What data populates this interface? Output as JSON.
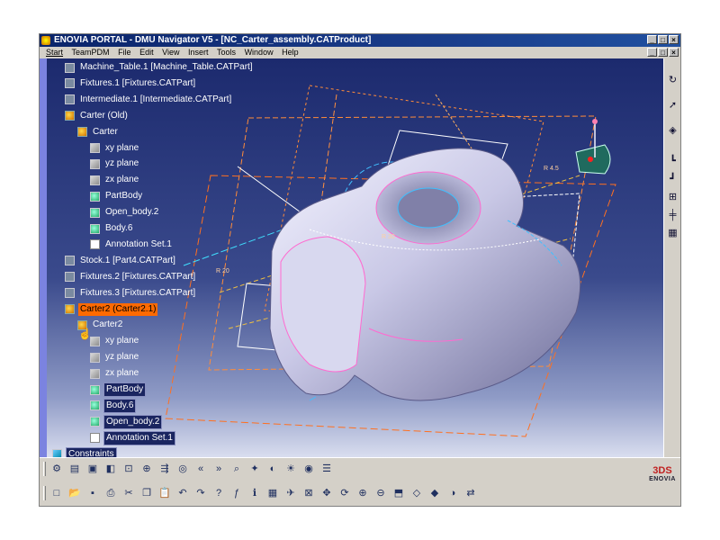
{
  "window": {
    "title": "ENOVIA PORTAL - DMU Navigator V5 - [NC_Carter_assembly.CATProduct]",
    "controls": [
      "_",
      "□",
      "×"
    ],
    "doc_controls": [
      "_",
      "□",
      "×"
    ]
  },
  "menubar": [
    "Start",
    "TeamPDM",
    "File",
    "Edit",
    "View",
    "Insert",
    "Tools",
    "Window",
    "Help"
  ],
  "tree": [
    {
      "label": "Machine_Table.1 [Machine_Table.CATPart]",
      "icon": "part-icon"
    },
    {
      "label": "Fixtures.1 [Fixtures.CATPart]",
      "icon": "part-icon"
    },
    {
      "label": "Intermediate.1 [Intermediate.CATPart]",
      "icon": "part-icon"
    },
    {
      "label": "Carter (Old)",
      "icon": "product-icon"
    },
    {
      "label": "Carter",
      "icon": "product-icon"
    },
    {
      "label": "xy plane",
      "icon": "plane-icon"
    },
    {
      "label": "yz plane",
      "icon": "plane-icon"
    },
    {
      "label": "zx plane",
      "icon": "plane-icon"
    },
    {
      "label": "PartBody",
      "icon": "body-icon"
    },
    {
      "label": "Open_body.2",
      "icon": "body-icon"
    },
    {
      "label": "Body.6",
      "icon": "body-icon"
    },
    {
      "label": "Annotation Set.1",
      "icon": "annotation-icon"
    },
    {
      "label": "Stock.1 [Part4.CATPart]",
      "icon": "part-icon"
    },
    {
      "label": "Fixtures.2 [Fixtures.CATPart]",
      "icon": "part-icon"
    },
    {
      "label": "Fixtures.3 [Fixtures.CATPart]",
      "icon": "part-icon"
    },
    {
      "label": "Carter2 (Carter2.1)",
      "icon": "product-icon"
    },
    {
      "label": "Carter2",
      "icon": "product-icon"
    },
    {
      "label": "xy plane",
      "icon": "plane-icon"
    },
    {
      "label": "yz plane",
      "icon": "plane-icon"
    },
    {
      "label": "zx plane",
      "icon": "plane-icon"
    },
    {
      "label": "PartBody",
      "icon": "body-icon"
    },
    {
      "label": "Body.6",
      "icon": "body-icon"
    },
    {
      "label": "Open_body.2",
      "icon": "body-icon"
    },
    {
      "label": "Annotation Set.1",
      "icon": "annotation-icon"
    },
    {
      "label": "Constraints",
      "icon": "constraints-icon"
    }
  ],
  "selected_item": "Carter2 (Carter2.1)",
  "right_toolbar": [
    "rotate-icon",
    "select-arrow-icon",
    "measure-icon",
    "tree-expand-icon",
    "tree-collapse-icon",
    "product-node-icon",
    "constraint-icon",
    "grid-icon"
  ],
  "bottom_toolbar_row1": [
    "clash-icon",
    "section-icon",
    "distance-icon",
    "annotation-icon",
    "group-icon",
    "filter-icon",
    "move-icon",
    "compass-icon",
    "previous-view-icon",
    "next-view-icon",
    "search-icon",
    "explode-icon",
    "swept-volume-icon",
    "light-icon",
    "camera-icon",
    "list-icon"
  ],
  "bottom_toolbar_row2": [
    "new-icon",
    "open-icon",
    "save-icon",
    "print-icon",
    "cut-icon",
    "copy-icon",
    "paste-icon",
    "undo-icon",
    "redo-icon",
    "help-icon",
    "formula-icon",
    "info-icon",
    "table-icon",
    "fly-icon",
    "fit-all-icon",
    "pan-icon",
    "rotate-view-icon",
    "zoom-in-icon",
    "zoom-out-icon",
    "normal-view-icon",
    "iso-view-icon",
    "render-icon",
    "hide-show-icon",
    "swap-icon"
  ],
  "logo": {
    "mark": "3DS",
    "text": "ENOVIA"
  },
  "colors": {
    "selection": "#ff6a00",
    "title_bar": "#0a246a",
    "viewport_top": "#1c2a6e",
    "viewport_bottom": "#d9ddef"
  }
}
